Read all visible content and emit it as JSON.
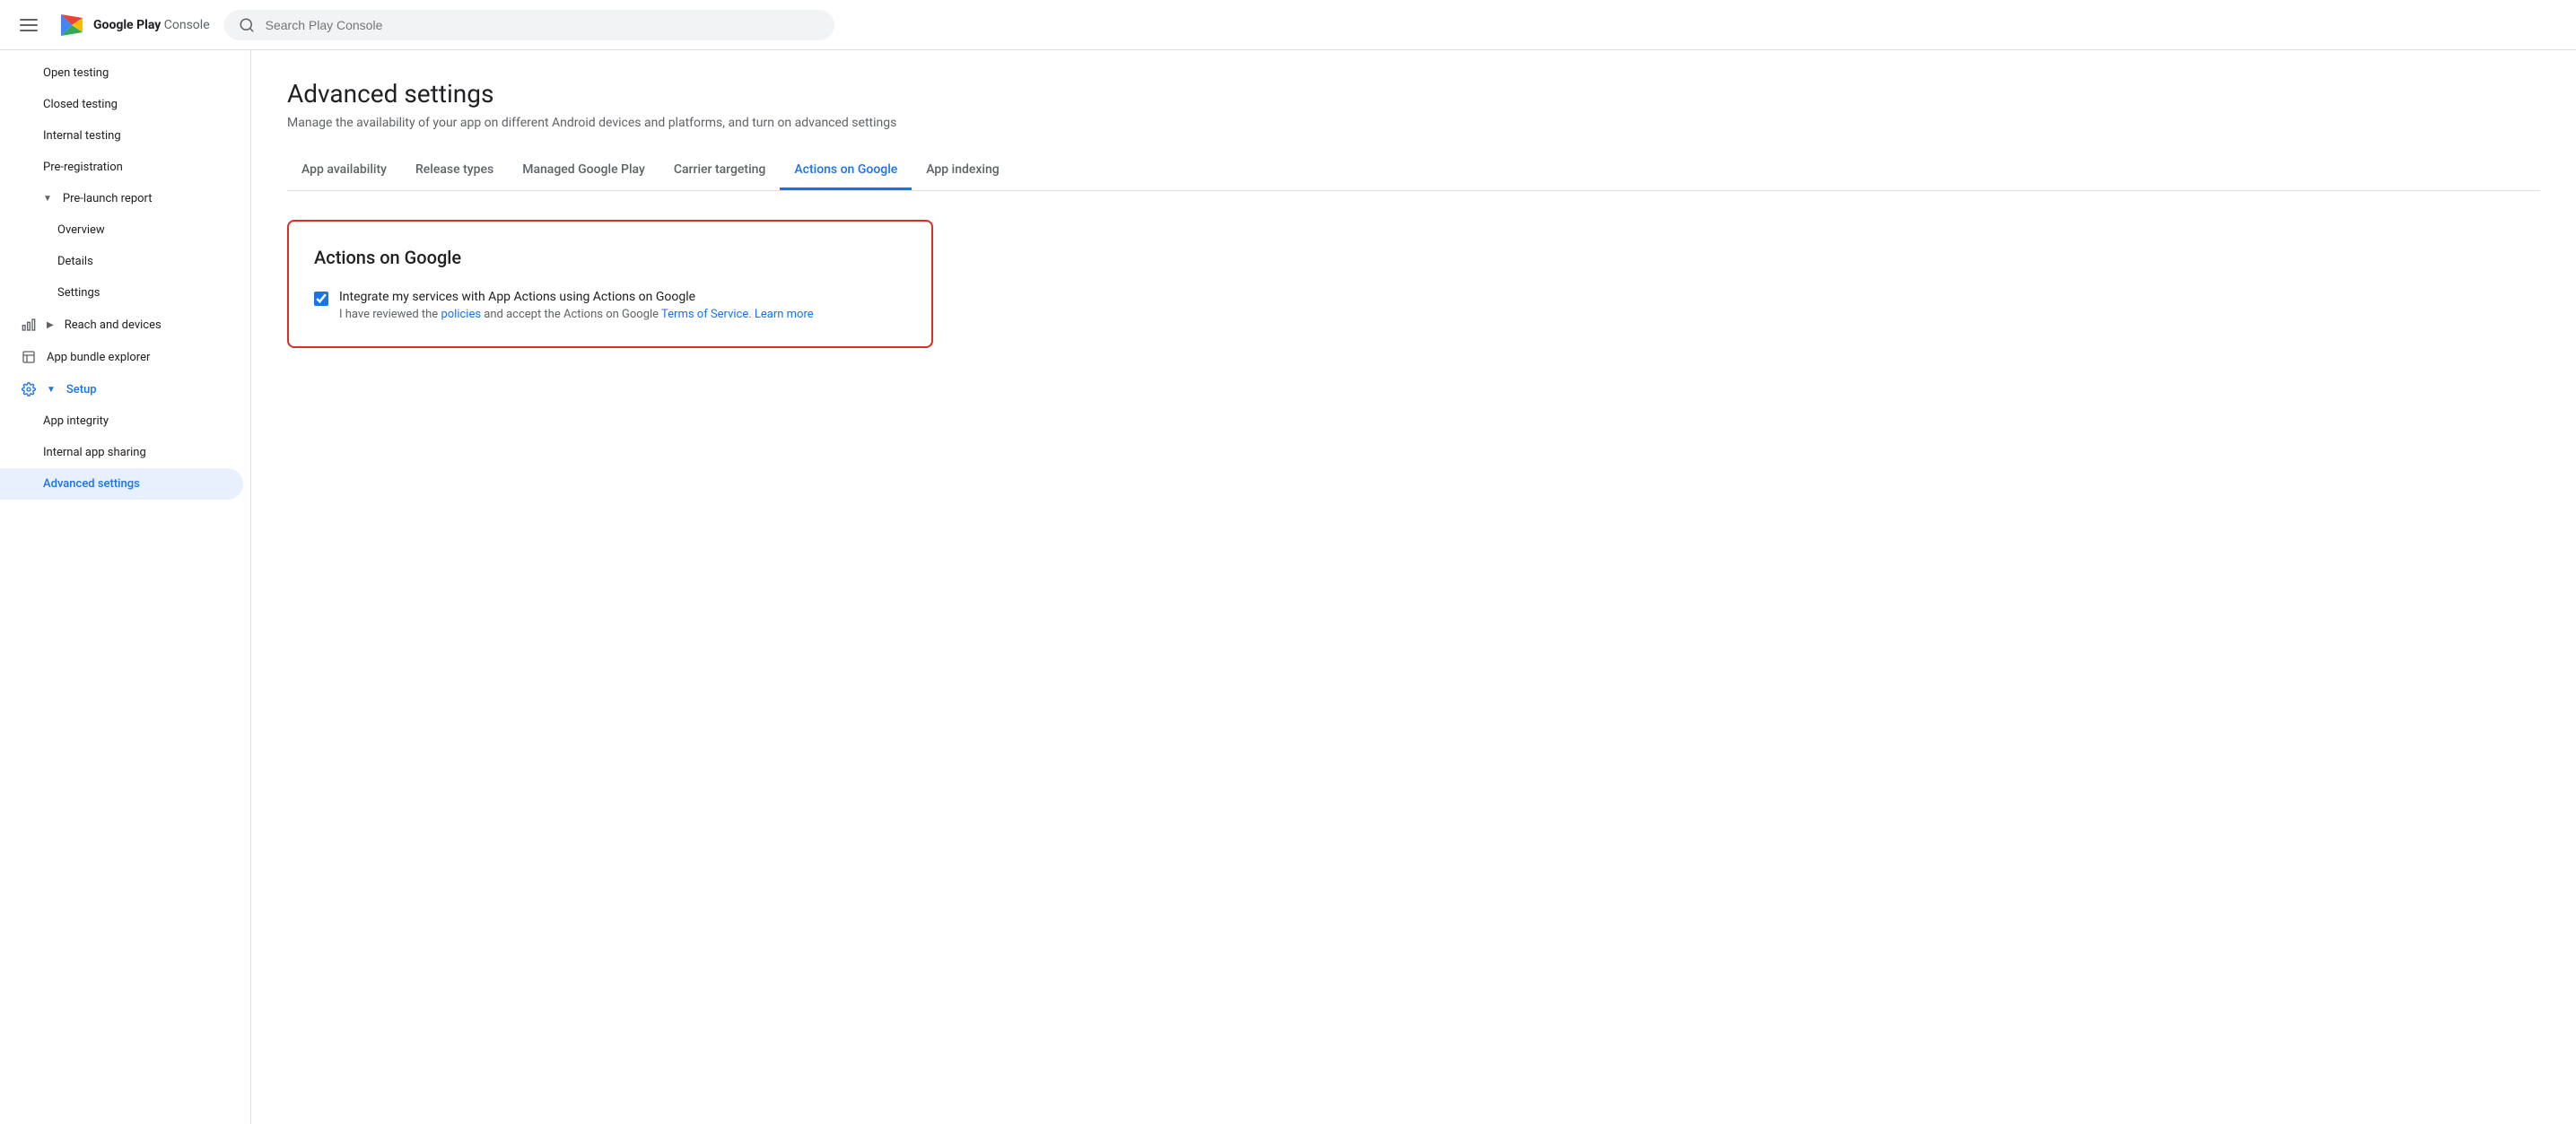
{
  "app": {
    "title": "Google Play Console",
    "title_strong": "Google Play",
    "title_light": "Console"
  },
  "search": {
    "placeholder": "Search Play Console"
  },
  "sidebar": {
    "items": [
      {
        "id": "open-testing",
        "label": "Open testing",
        "indent": 1,
        "icon": null
      },
      {
        "id": "closed-testing",
        "label": "Closed testing",
        "indent": 1,
        "icon": null
      },
      {
        "id": "internal-testing",
        "label": "Internal testing",
        "indent": 1,
        "icon": null
      },
      {
        "id": "pre-registration",
        "label": "Pre-registration",
        "indent": 1,
        "icon": null
      },
      {
        "id": "pre-launch-report",
        "label": "Pre-launch report",
        "indent": 1,
        "icon": null,
        "expandable": true,
        "expanded": true
      },
      {
        "id": "overview",
        "label": "Overview",
        "indent": 2,
        "icon": null
      },
      {
        "id": "details",
        "label": "Details",
        "indent": 2,
        "icon": null
      },
      {
        "id": "settings-pre",
        "label": "Settings",
        "indent": 2,
        "icon": null
      },
      {
        "id": "reach-and-devices",
        "label": "Reach and devices",
        "indent": 0,
        "icon": "chart-icon",
        "expandable": true
      },
      {
        "id": "app-bundle-explorer",
        "label": "App bundle explorer",
        "indent": 0,
        "icon": "bundle-icon"
      },
      {
        "id": "setup",
        "label": "Setup",
        "indent": 0,
        "icon": "gear-icon",
        "active_parent": true,
        "expandable": true,
        "expanded": true
      },
      {
        "id": "app-integrity",
        "label": "App integrity",
        "indent": 1,
        "icon": null
      },
      {
        "id": "internal-app-sharing",
        "label": "Internal app sharing",
        "indent": 1,
        "icon": null
      },
      {
        "id": "advanced-settings",
        "label": "Advanced settings",
        "indent": 1,
        "icon": null,
        "active": true
      }
    ]
  },
  "page": {
    "title": "Advanced settings",
    "subtitle": "Manage the availability of your app on different Android devices and platforms, and turn on advanced settings"
  },
  "tabs": [
    {
      "id": "app-availability",
      "label": "App availability",
      "active": false
    },
    {
      "id": "release-types",
      "label": "Release types",
      "active": false
    },
    {
      "id": "managed-google-play",
      "label": "Managed Google Play",
      "active": false
    },
    {
      "id": "carrier-targeting",
      "label": "Carrier targeting",
      "active": false
    },
    {
      "id": "actions-on-google",
      "label": "Actions on Google",
      "active": true
    },
    {
      "id": "app-indexing",
      "label": "App indexing",
      "active": false
    }
  ],
  "content": {
    "card_title": "Actions on Google",
    "checkbox_label": "Integrate my services with App Actions using Actions on Google",
    "checkbox_desc_before": "I have reviewed the ",
    "checkbox_desc_policies": "policies",
    "checkbox_desc_middle": " and accept the Actions on Google ",
    "checkbox_desc_tos": "Terms of Service.",
    "checkbox_desc_learn": " Learn more",
    "checkbox_checked": true
  }
}
